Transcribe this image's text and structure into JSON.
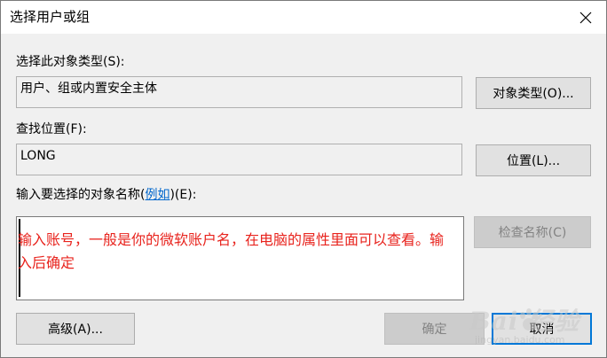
{
  "window": {
    "title": "选择用户或组"
  },
  "object_type": {
    "label": "选择此对象类型(S):",
    "value": "用户、组或内置安全主体",
    "button": "对象类型(O)..."
  },
  "location": {
    "label": "查找位置(F):",
    "value": "LONG",
    "button": "位置(L)..."
  },
  "names": {
    "label_prefix": "输入要选择的对象名称(",
    "label_link": "例如",
    "label_suffix": ")(E):",
    "check_button": "检查名称(C)"
  },
  "annotation": {
    "text": "输入账号，一般是你的微软账户名，在电脑的属性里面可以查看。输入后确定"
  },
  "footer": {
    "advanced_button": "高级(A)...",
    "ok_button": "确定",
    "cancel_button": "取消"
  },
  "watermark": {
    "brand": "Bai 经验",
    "url": "jingyan.baidu.com"
  },
  "colors": {
    "annotation": "#e8231d",
    "link": "#0066cc",
    "default_button_border": "#0078d7"
  },
  "icons": {
    "close": "close-icon",
    "watermark_logo": "baidu-paw-icon"
  }
}
